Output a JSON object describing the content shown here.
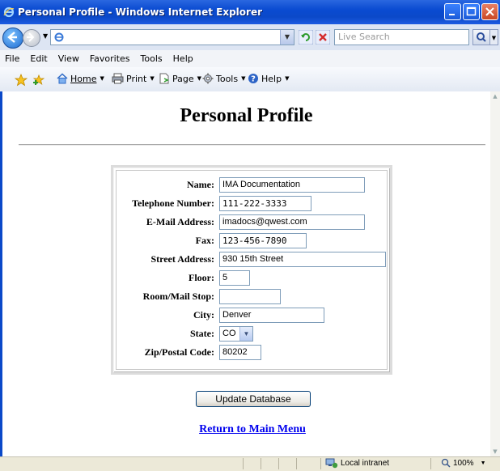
{
  "window": {
    "title": "Personal Profile - Windows Internet Explorer"
  },
  "address_bar": {
    "url": "",
    "search_placeholder": "Live Search"
  },
  "menu": [
    "File",
    "Edit",
    "View",
    "Favorites",
    "Tools",
    "Help"
  ],
  "command_bar": {
    "home": "Home",
    "print": "Print",
    "page": "Page",
    "tools": "Tools",
    "help": "Help"
  },
  "page": {
    "title": "Personal Profile",
    "fields": [
      {
        "label": "Name:",
        "value": "IMA Documentation"
      },
      {
        "label": "Telephone Number:",
        "value": "111-222-3333"
      },
      {
        "label": "E-Mail Address:",
        "value": "imadocs@qwest.com"
      },
      {
        "label": "Fax:",
        "value": "123-456-7890"
      },
      {
        "label": "Street Address:",
        "value": "930 15th Street"
      },
      {
        "label": "Floor:",
        "value": "5"
      },
      {
        "label": "Room/Mail Stop:",
        "value": ""
      },
      {
        "label": "City:",
        "value": "Denver"
      },
      {
        "label": "State:",
        "value": "CO"
      },
      {
        "label": "Zip/Postal Code:",
        "value": "80202"
      }
    ],
    "update_button": "Update Database",
    "return_link": "Return to Main Menu"
  },
  "status_bar": {
    "zone": "Local intranet",
    "zoom": "100%"
  },
  "colors": {
    "titlebar": "#0b49c9",
    "link": "#0000ee"
  }
}
